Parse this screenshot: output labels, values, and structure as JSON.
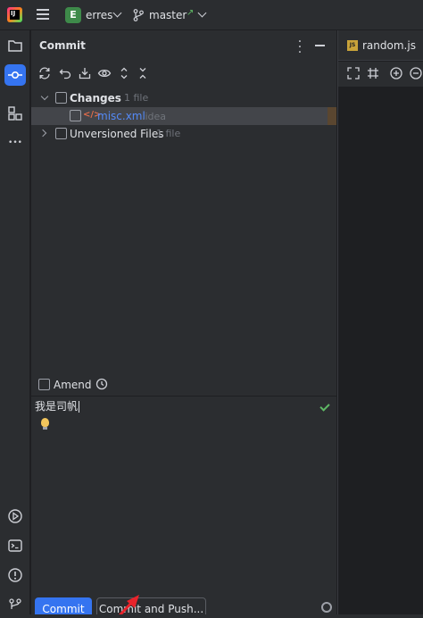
{
  "titlebar": {
    "project_badge": "E",
    "project_name": "erres",
    "branch_name": "master",
    "branch_arrow": "↗"
  },
  "leftbar": {
    "items": [
      "folder-icon",
      "commit-icon",
      "structure-icon",
      "more-icon",
      "run-icon",
      "terminal-icon",
      "problems-icon",
      "git-icon"
    ],
    "active": "commit-icon",
    "more_glyph": "•••"
  },
  "commit_panel": {
    "title": "Commit",
    "toolbar_icons": [
      "refresh-icon",
      "rollback-icon",
      "shelve-icon",
      "eye-icon",
      "expand-all-icon",
      "collapse-all-icon"
    ],
    "changes": {
      "label": "Changes",
      "count": "1 file",
      "files": [
        {
          "icon": "</>",
          "name": "misc.xml",
          "dir": ".idea"
        }
      ]
    },
    "unversioned": {
      "label": "Unversioned Files",
      "count": "1 file"
    },
    "amend_label": "Amend",
    "message": "我是司帆",
    "commit_button": "Commit",
    "commit_push_button": "Commit and Push..."
  },
  "editor": {
    "tab_label": "random.js",
    "js_badge": "JS",
    "toolbar_icons": [
      "fullscreen-icon",
      "grid-icon",
      "zoom-in-icon",
      "zoom-out-icon"
    ]
  },
  "colors": {
    "accent": "#3574f0",
    "panel_bg": "#2b2d30",
    "editor_bg": "#1e1f22",
    "file_link": "#548af7",
    "project_badge": "#3e8a4a",
    "annotation_arrow": "#e8232b"
  }
}
